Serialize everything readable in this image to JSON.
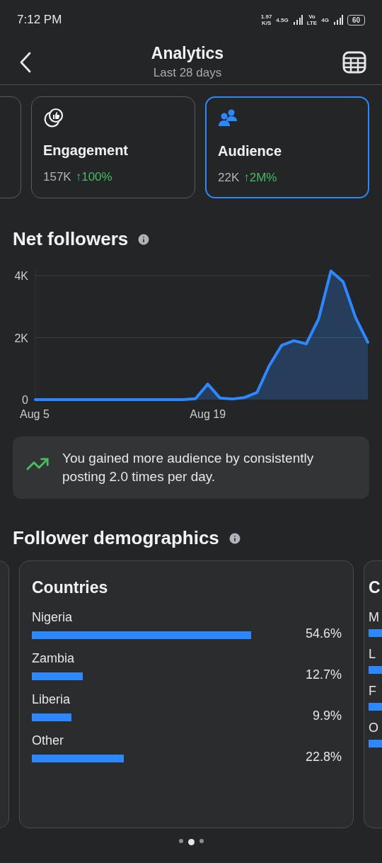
{
  "status_bar": {
    "time": "7:12 PM",
    "speed": "1.97",
    "speed_unit": "K/S",
    "network_1": "4.5G",
    "volte_top": "Vo",
    "volte_bottom": "LTE",
    "network_2": "4G",
    "battery": "60"
  },
  "header": {
    "title": "Analytics",
    "subtitle": "Last 28 days"
  },
  "metrics": [
    {
      "kind": "engagement",
      "label": "Engagement",
      "value": "157K",
      "change": "↑100%",
      "selected": false
    },
    {
      "kind": "audience",
      "label": "Audience",
      "value": "22K",
      "change": "↑2M%",
      "selected": true
    }
  ],
  "net_followers": {
    "title": "Net followers",
    "chart_data": {
      "type": "area",
      "categories": [
        "Aug 5",
        null,
        null,
        null,
        null,
        null,
        null,
        null,
        null,
        null,
        null,
        null,
        null,
        null,
        "Aug 19",
        null,
        null,
        null,
        null,
        null,
        null,
        null,
        null,
        null,
        null,
        null,
        null,
        null
      ],
      "series": [
        {
          "color": "#2d88ff",
          "values": [
            0,
            0,
            0,
            0,
            0,
            0,
            0,
            0,
            0,
            0,
            0,
            0,
            0,
            30,
            500,
            50,
            20,
            70,
            230,
            1100,
            1750,
            1900,
            1800,
            2600,
            4150,
            3800,
            2650,
            1850
          ]
        }
      ],
      "ylim": [
        0,
        4200
      ],
      "yticks": [
        {
          "value": 0,
          "label": "0"
        },
        {
          "value": 2000,
          "label": "2K"
        },
        {
          "value": 4000,
          "label": "4K"
        }
      ]
    }
  },
  "insight": {
    "text": "You gained more audience by consistently posting 2.0 times per day."
  },
  "demographics": {
    "title": "Follower demographics",
    "cards": [
      {
        "kind": "full",
        "title": "Countries",
        "items": [
          {
            "name": "Nigeria",
            "value": "54.6%"
          },
          {
            "name": "Zambia",
            "value": "12.7%"
          },
          {
            "name": "Liberia",
            "value": "9.9%"
          },
          {
            "name": "Other",
            "value": "22.8%"
          }
        ]
      },
      {
        "kind": "edge",
        "title": "C",
        "items": [
          {
            "name": "M"
          },
          {
            "name": "L"
          },
          {
            "name": "F"
          },
          {
            "name": "O"
          }
        ]
      }
    ]
  },
  "pages": [
    {
      "selected": false
    },
    {
      "selected": true
    },
    {
      "selected": false
    }
  ]
}
